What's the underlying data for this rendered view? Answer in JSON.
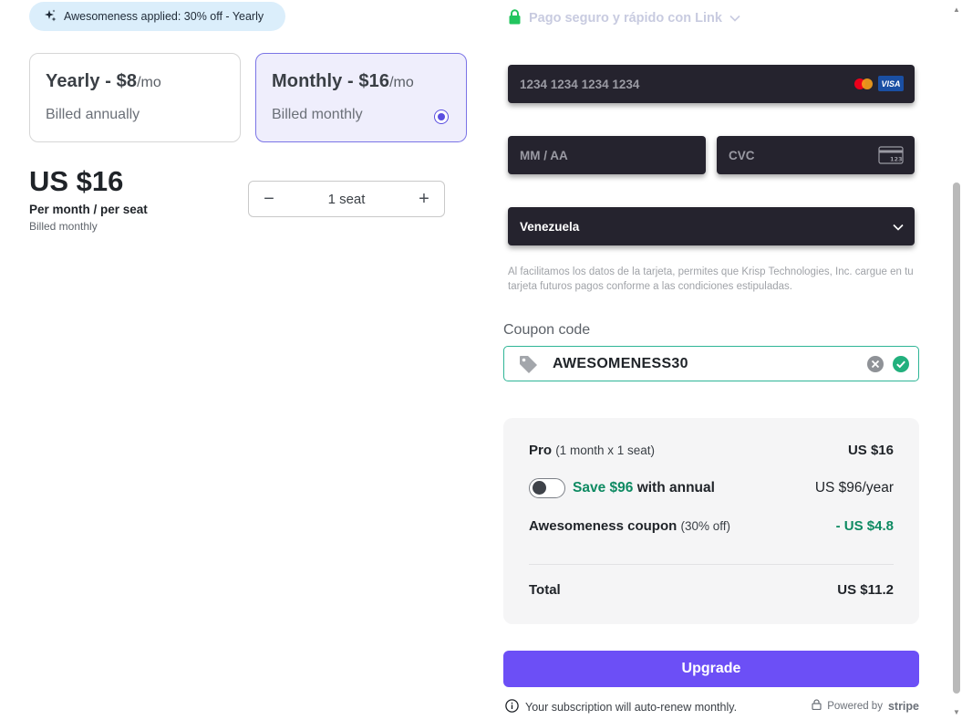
{
  "promo": {
    "text": "Awesomeness applied: 30% off - Yearly"
  },
  "plans": [
    {
      "title": "Yearly - $8",
      "unit": "/mo",
      "sub": "Billed annually"
    },
    {
      "title": "Monthly - $16",
      "unit": "/mo",
      "sub": "Billed monthly"
    }
  ],
  "price": {
    "amount": "US $16",
    "per": "Per month / per seat",
    "billed": "Billed monthly"
  },
  "seats": {
    "value": "1 seat",
    "minus": "−",
    "plus": "+"
  },
  "link": {
    "text": "Pago seguro y rápido con Link"
  },
  "card": {
    "number_placeholder": "1234 1234 1234 1234",
    "visa": "VISA",
    "expiry_placeholder": "MM / AA",
    "cvc_placeholder": "CVC",
    "cvc_icon_text": "123",
    "country": "Venezuela",
    "notice": "Al facilitamos los datos de la tarjeta, permites que Krisp Technologies, Inc. cargue en tu tarjeta futuros pagos conforme a las condiciones estipuladas."
  },
  "coupon": {
    "label": "Coupon code",
    "code": "AWESOMENESS30"
  },
  "summary": {
    "pro_label": "Pro",
    "pro_detail": "(1 month x 1 seat)",
    "pro_price": "US $16",
    "save_highlight": "Save $96",
    "save_text": "with annual",
    "save_price": "US $96/year",
    "save_toggle_on": false,
    "coupon_label": "Awesomeness coupon",
    "coupon_detail": "(30% off)",
    "coupon_price": "- US $4.8",
    "total_label": "Total",
    "total_price": "US $11.2"
  },
  "upgrade": {
    "label": "Upgrade"
  },
  "footer": {
    "renew": "Your subscription will auto-renew monthly.",
    "powered_by": "Powered by",
    "stripe": "stripe"
  },
  "colors": {
    "accent": "#6c4ff6",
    "success": "#2fb596",
    "green_text": "#0e8a62",
    "field_dark": "#25232e"
  }
}
